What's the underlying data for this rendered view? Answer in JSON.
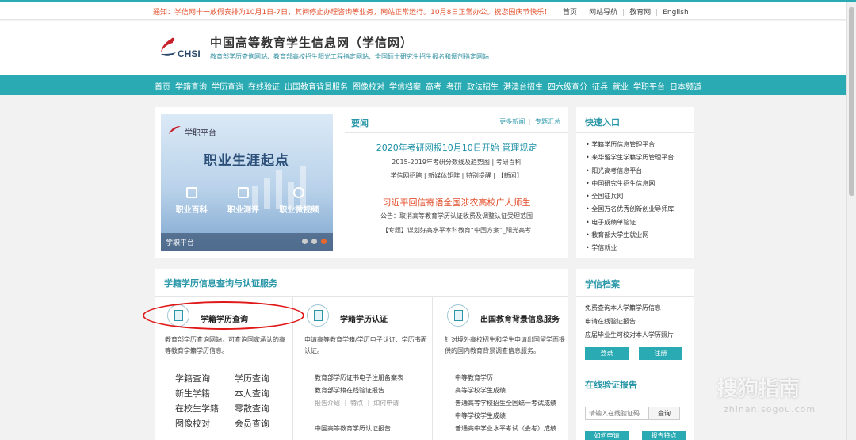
{
  "notice": {
    "text": "通知：学信网十一放假安排为10月1日-7日，其间停止办理咨询等业务，网站正常运行。10月8日正常办公。祝您国庆节快乐！",
    "links": [
      "首页",
      "网站导航",
      "教育网",
      "English"
    ]
  },
  "header": {
    "logo_text": "CHSI",
    "title": "中国高等教育学生信息网（学信网）",
    "subtitle": "教育部学历查询网站、教育部高校招生阳光工程指定网站、全国硕士研究生招生报名和调剂指定网站"
  },
  "nav": [
    "首页",
    "学籍查询",
    "学历查询",
    "在线验证",
    "出国教育背景服务",
    "图像校对",
    "学信档案",
    "高考",
    "考研",
    "政法招生",
    "港澳台招生",
    "四六级查分",
    "征兵",
    "就业",
    "学职平台",
    "日本频道"
  ],
  "banner": {
    "platform": "学职平台",
    "headline": "职业生涯起点",
    "cells": [
      "职业百科",
      "职业测评",
      "职业微视频"
    ],
    "footer": "学职平台"
  },
  "news": {
    "heading": "要闻",
    "more": "更多新闻",
    "topics": "专题汇总",
    "headline1": "2020年考研网报10月10日开始 管理规定",
    "sub1": "2015-2019年考研分数线及趋势图 | 考研百科",
    "sub1b": "学信网招聘 | 新媒体矩阵 | 特别提醒 | 【新闻】",
    "headline2": "习近平回信寄语全国涉农高校广大师生",
    "sub2": "公告：取消高等教育学历认证收费及调整认证受理范围",
    "sub2b": "【专题】谋划好高水平本科教育“中国方案”_阳光高考"
  },
  "quick": {
    "heading": "快速入口",
    "items": [
      "学籍学历信息管理平台",
      "来华留学生学籍学历管理平台",
      "阳光高考信息平台",
      "中国研究生招生信息网",
      "全国征兵网",
      "全国万名优秀创新创业导师库",
      "电子成绩单验证",
      "教育部大学生就业网",
      "学信就业"
    ]
  },
  "services": {
    "heading": "学籍学历信息查询与认证服务",
    "col1": {
      "title": "学籍学历查询",
      "desc": "教育部学历查询网站，可查询国家承认的高等教育学籍学历信息。",
      "links": [
        "学籍查询",
        "学历查询",
        "新生学籍",
        "本人查询",
        "在校生学籍",
        "零散查询",
        "图像校对",
        "会员查询"
      ]
    },
    "col2": {
      "title": "学籍学历认证",
      "desc": "申请高等教育学籍/学历电子认证、学历书面认证。",
      "links": [
        "教育部学历证书电子注册备案表",
        "教育部学籍在线验证报告",
        "报告介绍 ｜ 特点 ｜ 如何申请",
        "",
        "中国高等教育学历认证报告"
      ]
    },
    "col3": {
      "title": "出国教育背景信息服务",
      "desc": "针对境外高校招生和学生申请出国留学而提供的国内教育背景调查信息服务。",
      "links": [
        "中等教育学历",
        "高等学校学生成绩",
        "普通高等学校招生全国统一考试成绩",
        "中等学校学生成绩",
        "普通高中学业水平考试（会考）成绩"
      ]
    }
  },
  "archive": {
    "heading": "学信档案",
    "lines": [
      "免费查询本人学籍学历信息",
      "申请在线验证报告",
      "应届毕业生可校对本人学历照片"
    ],
    "login": "登录",
    "register": "注册",
    "verify_heading": "在线验证报告",
    "verify_placeholder": "请输入在线验证码",
    "verify_button": "查询",
    "apply": "如何申请",
    "report": "报告特点"
  },
  "watermark": {
    "brand": "搜狗指南",
    "url": "zhinan.sogou.com"
  },
  "colors": {
    "accent": "#2aabb3",
    "notice_red": "#e3502d",
    "highlight_red": "#e01818"
  }
}
